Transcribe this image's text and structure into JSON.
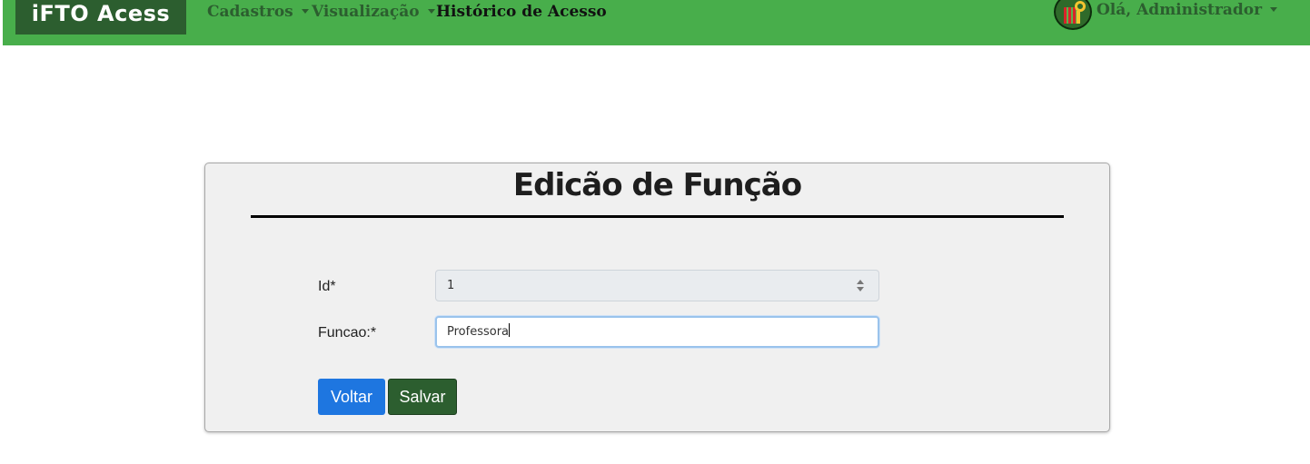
{
  "navbar": {
    "brand": "iFTO Acess",
    "items": [
      {
        "label": "Cadastros",
        "has_dropdown": true
      },
      {
        "label": "Visualização",
        "has_dropdown": true
      },
      {
        "label": "Histórico de Acesso",
        "has_dropdown": false
      }
    ],
    "user_menu": {
      "label": "Olá, Administrador",
      "avatar_icon": "ifto-key-logo-icon"
    },
    "colors": {
      "bar": "#48ae4b",
      "brand_bg": "#2c5e2f",
      "link": "#2c5e2f"
    }
  },
  "form": {
    "title": "Edicão de Função",
    "fields": [
      {
        "label": "Id*",
        "value": "1",
        "disabled": true
      },
      {
        "label": "Funcao:*",
        "value": "Professora",
        "focused": true
      }
    ],
    "buttons": {
      "back": "Voltar",
      "save": "Salvar"
    },
    "colors": {
      "back": "#1e76e0",
      "save": "#2c5e2f"
    }
  }
}
